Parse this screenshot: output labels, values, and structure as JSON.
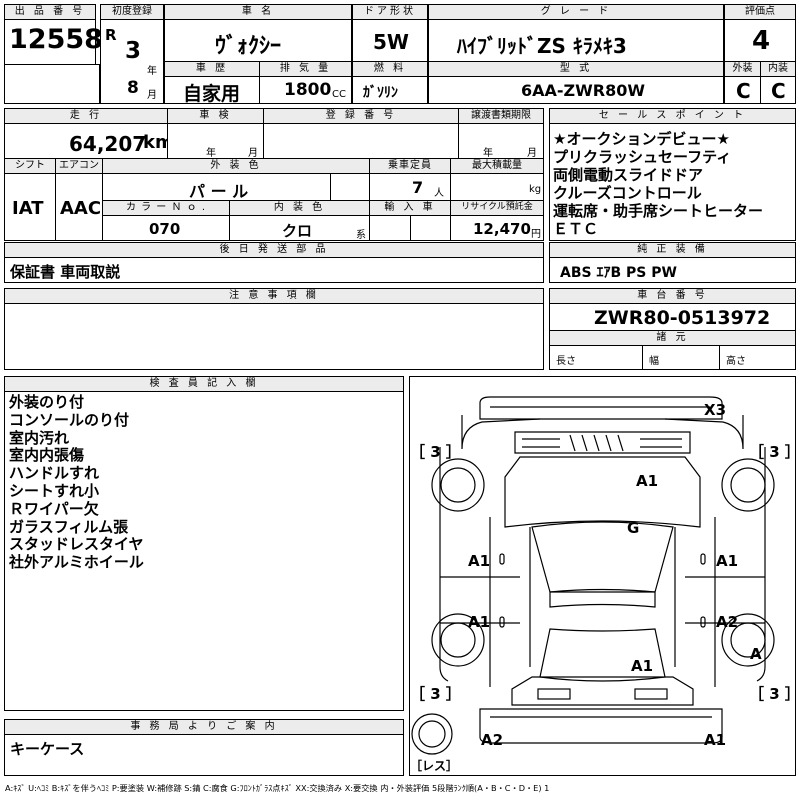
{
  "header": {
    "lot_no_label": "出 品 番 号",
    "lot_no": "12558",
    "first_reg_label": "初度登録",
    "era": "R",
    "year": "3",
    "year_unit": "年",
    "month": "8",
    "month_unit": "月",
    "car_name_label": "車 名",
    "car_name": "ｳﾞｫｸｼｰ",
    "history_label": "車 歴",
    "history": "自家用",
    "displacement_label": "排 気 量",
    "displacement": "1800",
    "displacement_unit": "CC",
    "door_label": "ドア形状",
    "door": "5W",
    "fuel_label": "燃 料",
    "fuel": "ｶﾞｿﾘﾝ",
    "grade_label": "グ レ ー ド",
    "grade": "ﾊｲﾌﾞﾘｯﾄﾞZS ｷﾗﾒｷ3",
    "model_label": "型 式",
    "model": "6AA-ZWR80W",
    "score_label": "評価点",
    "score": "4",
    "exterior_label": "外装",
    "exterior": "C",
    "interior_label": "内装",
    "interior": "C"
  },
  "row2": {
    "mileage_label": "走 行",
    "mileage": "64,207",
    "mileage_unit": "km",
    "inspection_label": "車 検",
    "year_unit": "年",
    "month_unit": "月",
    "plate_label": "登 録 番 号",
    "transfer_label": "譲渡書類期限",
    "shift_label": "シフト",
    "shift": "IAT",
    "ac_label": "エアコン",
    "ac": "AAC",
    "color_label": "外 装 色",
    "color": "パ ー ル",
    "capacity_label": "乗車定員",
    "capacity": "7",
    "capacity_unit": "人",
    "load_label": "最大積載量",
    "load_unit": "kg",
    "color_no_label": "カ ラ ー Ｎ ｏ .",
    "color_no": "070",
    "interior_color_label": "内 装 色",
    "interior_color": "クロ",
    "interior_color_unit": "系",
    "import_label": "輸 入 車",
    "recycle_label": "リサイクル預託金",
    "recycle": "12,470",
    "recycle_unit": "円"
  },
  "sales_points": {
    "label": "セ ー ル ス ポ イ ン ト",
    "items": [
      "★オークションデビュー★",
      "プリクラッシュセーフティ",
      "両側電動スライドドア",
      "クルーズコントロール",
      "運転席・助手席シートヒーター",
      "ＥＴＣ"
    ]
  },
  "deferred_parts": {
    "label": "後 日 発 送 部 品",
    "value": "保証書 車両取説"
  },
  "genuine_equipment": {
    "label": "純 正 装 備",
    "value": "ABS ｴｱB PS PW"
  },
  "notes": {
    "label": "注 意 事 項 欄"
  },
  "chassis": {
    "label": "車 台 番 号",
    "value": "ZWR80-0513972",
    "dims_label": "諸 元",
    "length_label": "長さ",
    "width_label": "幅",
    "height_label": "高さ"
  },
  "inspector": {
    "label": "検 査 員 記 入 欄",
    "items": [
      "外装のり付",
      "コンソールのり付",
      "室内汚れ",
      "室内内張傷",
      "ハンドルすれ",
      "シートすれ小",
      "Ｒワイパー欠",
      "ガラスフィルム張",
      "スタッドレスタイヤ",
      "社外アルミホイール"
    ]
  },
  "diagram": {
    "tire_fl": "［ 3 ］",
    "tire_fr": "［ 3 ］",
    "tire_rl": "［ 3 ］",
    "tire_rr": "［ 3 ］",
    "spare": "［レス］",
    "marks": {
      "front_bumper": "X3",
      "hood": "A1",
      "windshield": "G",
      "left_front_door": "A1",
      "right_front_door": "A1",
      "left_rear_door": "A1",
      "right_rear_door": "A2",
      "roof_rear": "A1",
      "right_rear_wheel": "A",
      "rear_bumper_left": "A2",
      "rear_bumper_right": "A1"
    }
  },
  "office": {
    "label": "事 務 局 よ り ご 案 内",
    "value": "キーケース"
  },
  "legend": "A:ｷｽﾞ U:ﾍｺﾐ B:ｷｽﾞを伴うﾍｺﾐ P:要塗装 W:補修跡 S:錆 C:腐食 G:ﾌﾛﾝﾄｶﾞﾗｽ点ｷｽﾞ XX:交換済み X:要交換 内・外装評価 5段階ﾗﾝｸ順(A・B・C・D・E) 1"
}
